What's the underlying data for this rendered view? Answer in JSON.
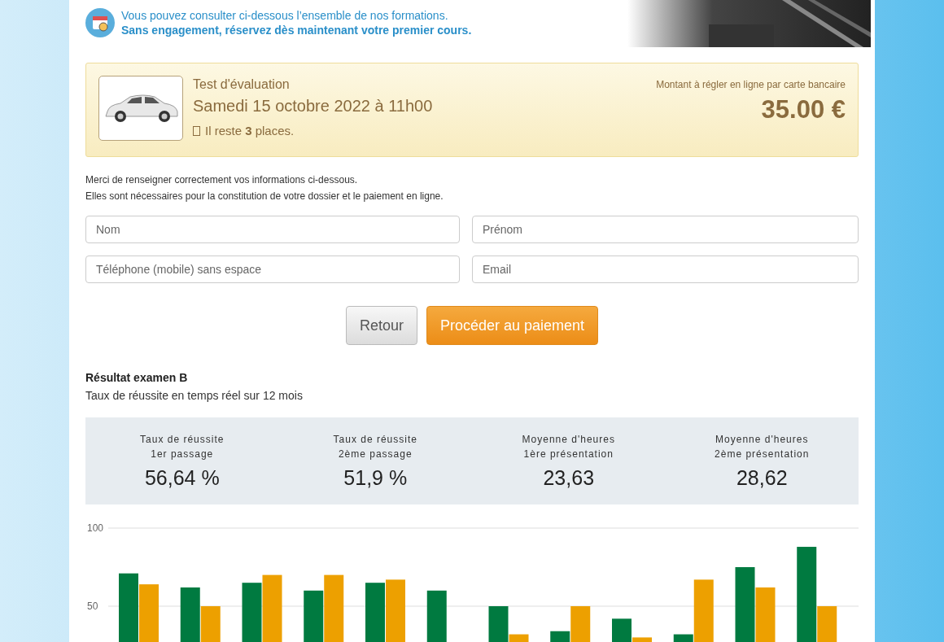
{
  "intro": {
    "line1": "Vous pouvez consulter ci-dessous l’ensemble de nos formations.",
    "line2": "Sans engagement, réservez dès maintenant votre premier cours."
  },
  "booking": {
    "title": "Test d'évaluation",
    "date": "Samedi 15 octobre 2022 à 11h00",
    "remaining": "Il reste **3** places.",
    "amount_label": "Montant à régler en ligne par carte bancaire",
    "amount": "35.00 €"
  },
  "form": {
    "notes": [
      "Merci de renseigner correctement vos informations ci-dessous.",
      "Elles sont nécessaires pour la constitution de votre dossier et le paiement en ligne."
    ],
    "fields": [
      {
        "placeholder": "Nom"
      },
      {
        "placeholder": "Prénom"
      },
      {
        "placeholder": "Téléphone (mobile) sans espace"
      },
      {
        "placeholder": "Email"
      }
    ],
    "buttons": [
      {
        "label": "Retour",
        "kind": "secondary"
      },
      {
        "label": "Procéder au paiement",
        "kind": "primary"
      }
    ]
  },
  "results": {
    "title": "Résultat examen B",
    "subtitle": "Taux de réussite en temps réel sur 12 mois",
    "stats": [
      {
        "label1": "Taux de réussite",
        "label2": "1er passage",
        "value": "56,64 %"
      },
      {
        "label1": "Taux de réussite",
        "label2": "2ème passage",
        "value": "51,9 %"
      },
      {
        "label1": "Moyenne d'heures",
        "label2": "1ère présentation",
        "value": "23,63"
      },
      {
        "label1": "Moyenne d'heures",
        "label2": "2ème présentation",
        "value": "28,62"
      }
    ],
    "chart_data": {
      "type": "bar",
      "ylim": [
        0,
        100
      ],
      "yticks": [
        50,
        100
      ],
      "series": [
        {
          "color": "#007a40",
          "values": [
            71,
            62,
            65,
            60,
            65,
            60,
            50,
            34,
            42,
            32,
            75,
            88
          ]
        },
        {
          "color": "#eda000",
          "values": [
            64,
            50,
            70,
            70,
            67,
            null,
            32,
            50,
            30,
            67,
            62,
            50
          ]
        }
      ]
    }
  }
}
